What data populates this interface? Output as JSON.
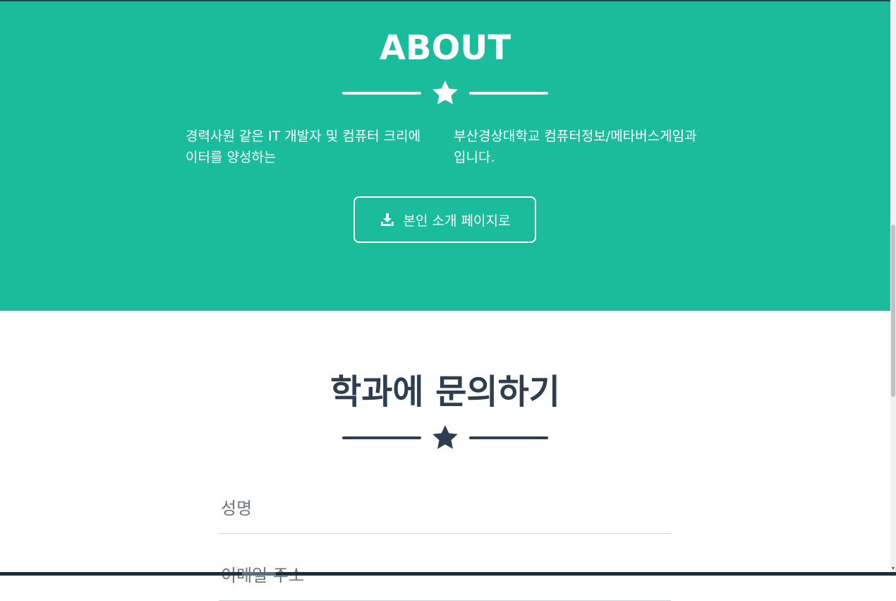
{
  "about": {
    "title": "ABOUT",
    "text_left": "경력사원 같은 IT 개발자 및 컴퓨터 크리에이터를 양성하는",
    "text_right": "부산경상대학교 컴퓨터정보/메타버스게임과 입니다.",
    "button_label": "본인 소개 페이지로",
    "button_icon": "download-icon",
    "divider_icon": "star-icon"
  },
  "contact": {
    "title": "학과에 문의하기",
    "divider_icon": "star-icon",
    "fields": [
      {
        "placeholder": "성명"
      },
      {
        "placeholder": "이메일 주소"
      }
    ]
  },
  "colors": {
    "primary": "#1abc9c",
    "secondary": "#2c3e50",
    "white": "#ffffff"
  }
}
